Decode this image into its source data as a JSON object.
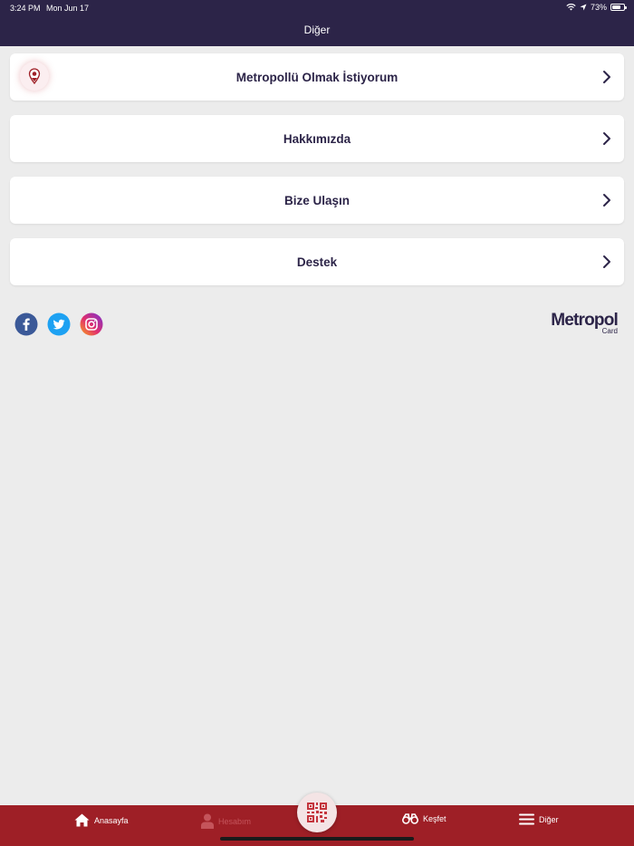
{
  "status_bar": {
    "time": "3:24 PM",
    "date": "Mon Jun 17",
    "battery": "73%",
    "battery_level": 0.73
  },
  "header": {
    "title": "Diğer"
  },
  "menu": {
    "items": [
      {
        "label": "Metropollü Olmak İstiyorum",
        "icon": "map-pin-icon"
      },
      {
        "label": "Hakkımızda"
      },
      {
        "label": "Bize Ulaşın"
      },
      {
        "label": "Destek"
      }
    ]
  },
  "social": [
    "facebook-icon",
    "twitter-icon",
    "instagram-icon"
  ],
  "brand": {
    "name": "Metropol",
    "sub": "Card"
  },
  "tabbar": {
    "items": [
      {
        "label": "Anasayfa",
        "icon": "home-icon",
        "enabled": true
      },
      {
        "label": "Hesabım",
        "icon": "user-icon",
        "enabled": false
      },
      {
        "label": "Keşfet",
        "icon": "binoculars-icon",
        "enabled": true
      },
      {
        "label": "Diğer",
        "icon": "menu-icon",
        "enabled": true
      }
    ],
    "center_icon": "qr-code-icon"
  },
  "colors": {
    "header_bg": "#2c2448",
    "accent": "#9e1f26",
    "background": "#ececec",
    "text_primary": "#2c2448"
  }
}
